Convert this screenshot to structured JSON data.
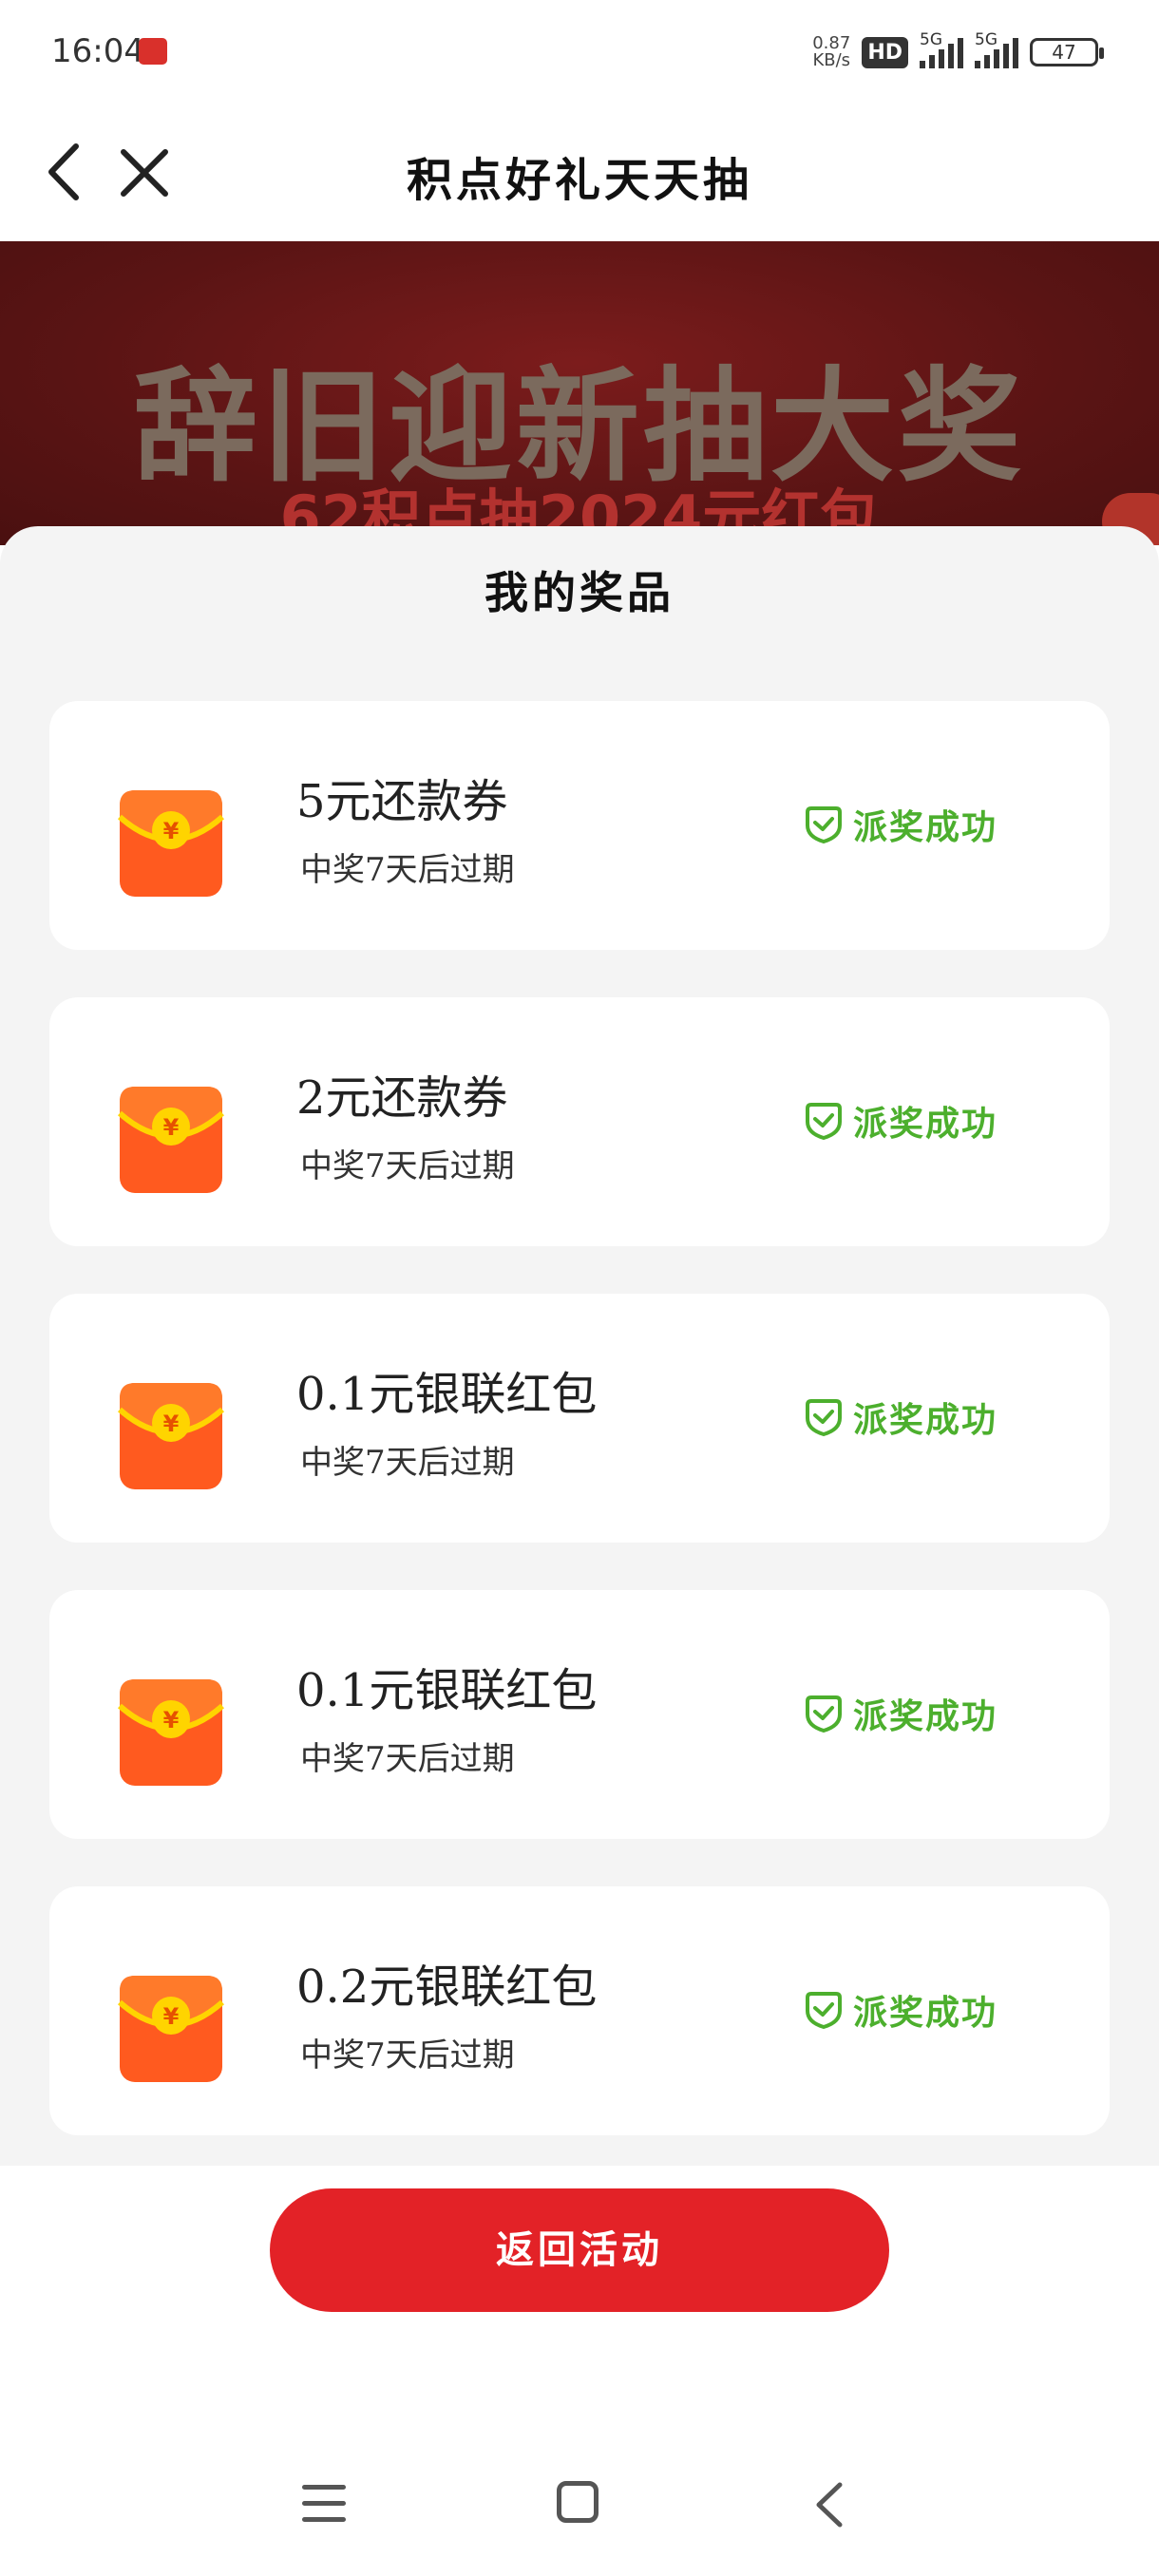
{
  "status_bar": {
    "time": "16:04",
    "net_speed_value": "0.87",
    "net_speed_unit": "KB/s",
    "hd_label": "HD",
    "signal1_label": "5G",
    "signal2_label": "5G",
    "battery": "47"
  },
  "nav": {
    "title": "积点好礼天天抽",
    "back_icon": "chevron-left-icon",
    "close_icon": "close-icon"
  },
  "banner": {
    "title": "辞旧迎新抽大奖",
    "subtitle": "62积点抽2024元红包"
  },
  "sheet": {
    "title": "我的奖品",
    "prizes": [
      {
        "name": "5元还款券",
        "expire": "中奖7天后过期",
        "status": "派奖成功"
      },
      {
        "name": "2元还款券",
        "expire": "中奖7天后过期",
        "status": "派奖成功"
      },
      {
        "name": "0.1元银联红包",
        "expire": "中奖7天后过期",
        "status": "派奖成功"
      },
      {
        "name": "0.1元银联红包",
        "expire": "中奖7天后过期",
        "status": "派奖成功"
      },
      {
        "name": "0.2元银联红包",
        "expire": "中奖7天后过期",
        "status": "派奖成功"
      }
    ]
  },
  "footer": {
    "back_button_label": "返回活动"
  },
  "colors": {
    "accent_red": "#e32227",
    "success_green": "#4caf2d",
    "sheet_bg": "#f4f4f4"
  }
}
